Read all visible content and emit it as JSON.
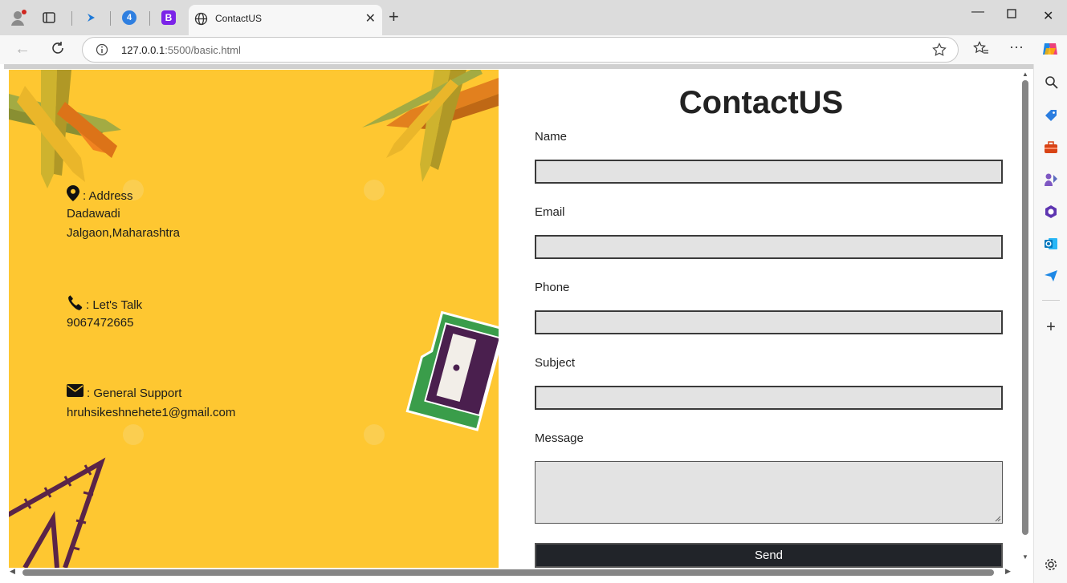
{
  "browser": {
    "tab_title": "ContactUS",
    "tab_badge_4": "4",
    "tab_badge_b": "B",
    "url_host": "127.0.0.1",
    "url_rest": ":5500/basic.html"
  },
  "contact": {
    "address_label": ": Address",
    "address_line1": "Dadawadi",
    "address_line2": "Jalgaon,Maharashtra",
    "talk_label": ": Let's Talk",
    "phone_number": "9067472665",
    "support_label": ": General Support",
    "support_email": "hruhsikeshnehete1@gmail.com"
  },
  "form": {
    "title": "ContactUS",
    "name_label": "Name",
    "email_label": "Email",
    "phone_label": "Phone",
    "subject_label": "Subject",
    "message_label": "Message",
    "send_label": "Send"
  },
  "colors": {
    "panel_bg": "#fec731",
    "button_bg": "#212429",
    "input_bg": "#e3e3e3"
  }
}
